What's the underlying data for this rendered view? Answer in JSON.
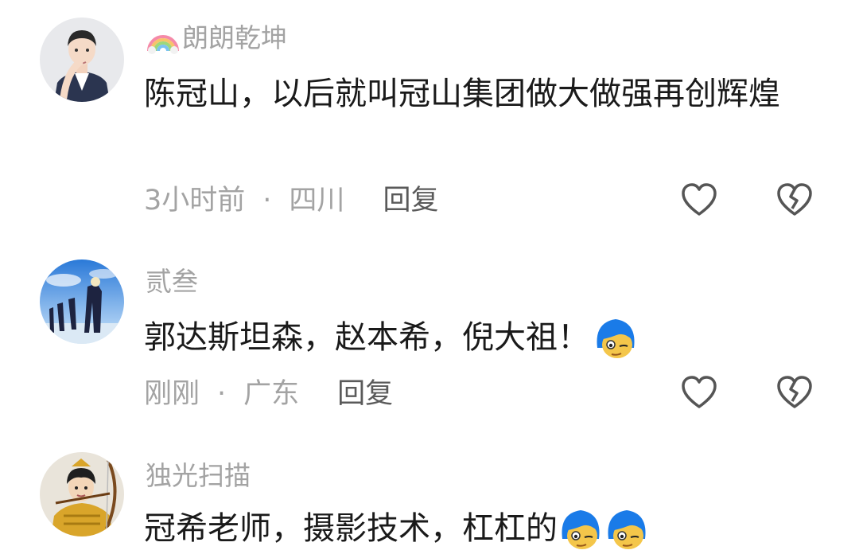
{
  "comments": [
    {
      "username": "朗朗乾坤",
      "text": "陈冠山，以后就叫冠山集团做大做强再创辉煌",
      "time": "3小时前",
      "location": "四川",
      "reply_label": "回复",
      "username_badge": "rainbow-icon",
      "avatar": "cartoon-man-avatar"
    },
    {
      "username": "贰叁",
      "text": "郭达斯坦森，赵本希，倪大祖！",
      "time": "刚刚",
      "location": "广东",
      "reply_label": "回复",
      "emoji_count": 1,
      "avatar": "anime-figures-avatar"
    },
    {
      "username": "独光扫描",
      "text": "冠希老师，摄影技术，杠杠的",
      "emoji_count": 2,
      "avatar": "archer-avatar"
    }
  ],
  "icons": {
    "like": "heart-outline-icon",
    "dislike": "broken-heart-icon",
    "emoji": "blue-hair-face-emoji"
  },
  "colors": {
    "text": "#1a1a1a",
    "secondary": "#a3a3a3",
    "reply": "#5a5a5a",
    "icon": "#555555",
    "emoji_hair": "#1a7be8"
  }
}
